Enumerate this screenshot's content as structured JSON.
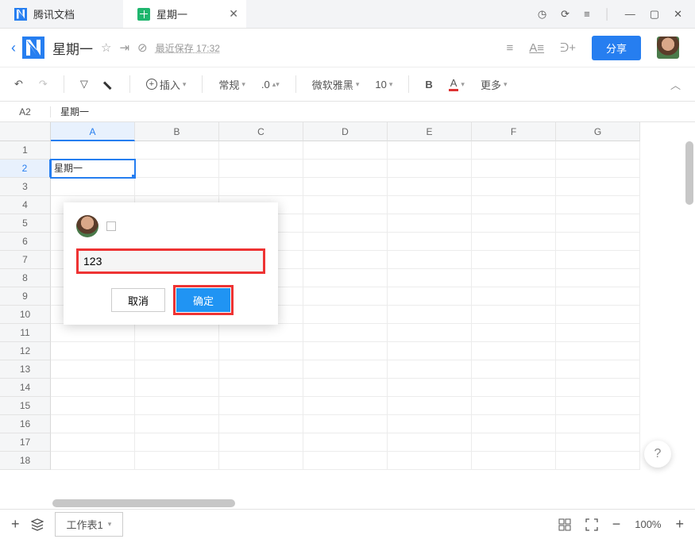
{
  "tabs": {
    "home": "腾讯文档",
    "doc": "星期一"
  },
  "header": {
    "title": "星期一",
    "save_status": "最近保存 17:32",
    "share_label": "分享"
  },
  "toolbar": {
    "insert": "插入",
    "format_number": "常规",
    "decimal": ".0",
    "font": "微软雅黑",
    "font_size": "10",
    "bold": "B",
    "text_color": "A",
    "more": "更多"
  },
  "fx": {
    "ref": "A2",
    "value": "星期一"
  },
  "grid": {
    "columns": [
      "A",
      "B",
      "C",
      "D",
      "E",
      "F",
      "G"
    ],
    "row_count": 18,
    "active_row": 2,
    "active_col": 0,
    "cells": {
      "A2": "星期一"
    }
  },
  "popup": {
    "input_value": "123",
    "cancel": "取消",
    "ok": "确定"
  },
  "bottom": {
    "sheet_name": "工作表1",
    "zoom": "100%"
  }
}
